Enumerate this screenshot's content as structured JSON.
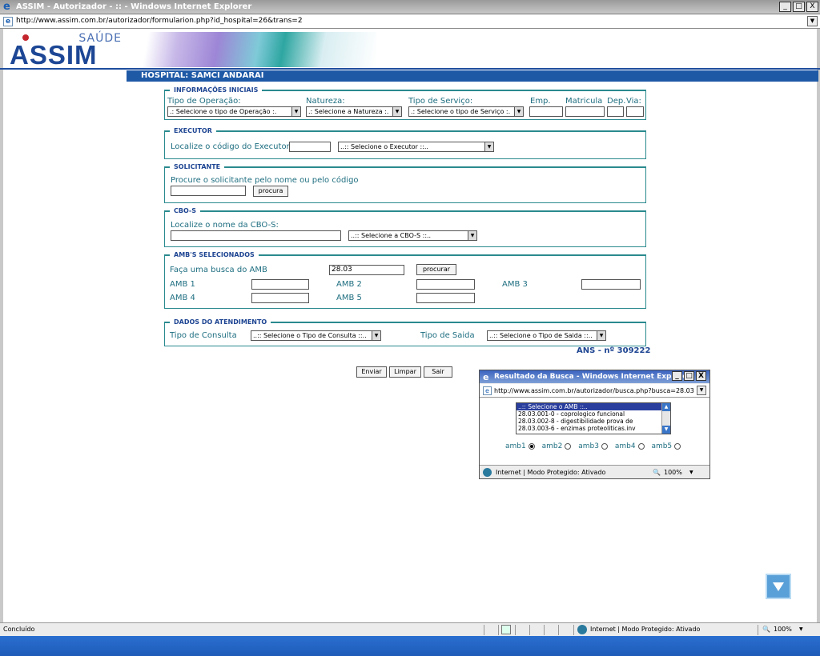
{
  "window": {
    "title": "ASSIM - Autorizador - :: - Windows Internet Explorer",
    "url": "http://www.assim.com.br/autorizador/formularion.php?id_hospital=26&trans=2",
    "minimize": "_",
    "maximize": "□",
    "close": "X"
  },
  "logo": {
    "top": "SAÚDE",
    "main": "ASSIM"
  },
  "header": {
    "hospital": "HOSPITAL: SAMCI ANDARAI"
  },
  "sections": {
    "iniciais": {
      "legend": "INFORMAÇÕES INICIAIS",
      "tipo_op_label": "Tipo de Operação:",
      "tipo_op_select": ".: Selecione o tipo de Operação :.",
      "natureza_label": "Natureza:",
      "natureza_select": ".: Selecione a Natureza :.",
      "tipo_serv_label": "Tipo de Serviço:",
      "tipo_serv_select": ".: Selecione o tipo de Serviço :.",
      "emp_label": "Emp.",
      "matricula_label": "Matricula",
      "dep_label": "Dep.",
      "via_label": "Via:"
    },
    "executor": {
      "legend": "EXECUTOR",
      "label": "Localize o código do Executor:",
      "select": "..:: Selecione o Executor ::.."
    },
    "solicitante": {
      "legend": "SOLICITANTE",
      "label": "Procure o solicitante pelo nome ou pelo código",
      "button": "procura"
    },
    "cbos": {
      "legend": "CBO-S",
      "label": "Localize o nome da CBO-S:",
      "select": "..:: Selecione a CBO-S ::.."
    },
    "amb": {
      "legend": "AMB'S SELECIONADOS",
      "search_label": "Faça uma busca do AMB",
      "search_value": "28.03",
      "button": "procurar",
      "amb1": "AMB 1",
      "amb2": "AMB 2",
      "amb3": "AMB 3",
      "amb4": "AMB 4",
      "amb5": "AMB 5"
    },
    "atendimento": {
      "legend": "DADOS DO ATENDIMENTO",
      "consulta_label": "Tipo de Consulta",
      "consulta_select": "..:: Selecione o Tipo de Consulta ::..",
      "saida_label": "Tipo de Saida",
      "saida_select": "..:: Selecione o Tipo de Saida ::.."
    }
  },
  "ans": "ANS - nº 309222",
  "actions": {
    "enviar": "Enviar",
    "limpar": "Limpar",
    "sair": "Sair"
  },
  "popup": {
    "title": "Resultado da Busca - Windows Internet Explorer",
    "url": "http://www.assim.com.br/autorizador/busca.php?busca=28.03",
    "items": [
      "..:: Selecione o AMB ::..",
      "28.03.001-0 - coprologico funcional",
      "28.03.002-8 - digestibilidade prova de",
      "28.03.003-6 - enzimas proteoliticas.inv"
    ],
    "radios": [
      "amb1",
      "amb2",
      "amb3",
      "amb4",
      "amb5"
    ],
    "status": "Internet | Modo Protegido: Ativado",
    "zoom": "100%"
  },
  "statusbar": {
    "left": "Concluído",
    "zone": "Internet | Modo Protegido: Ativado",
    "zoom": "100%"
  }
}
